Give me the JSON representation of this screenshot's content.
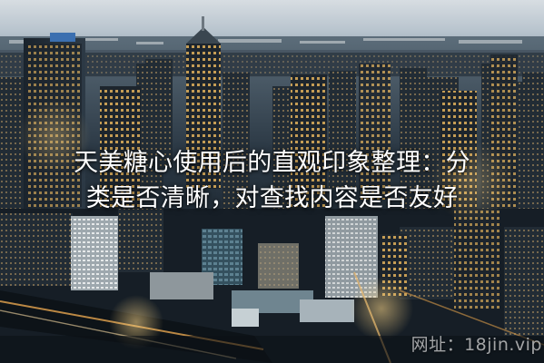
{
  "headline": {
    "line1": "天美糖心使用后的直观印象整理：分",
    "line2": "类是否清晰，对查找内容是否友好"
  },
  "watermark": {
    "text": "网址：18jin.vip"
  },
  "colors": {
    "sky": "#c9d3dc",
    "night_city": "#1b2530",
    "window_lights": "#f2c86a",
    "headline_text": "#ffffff"
  }
}
